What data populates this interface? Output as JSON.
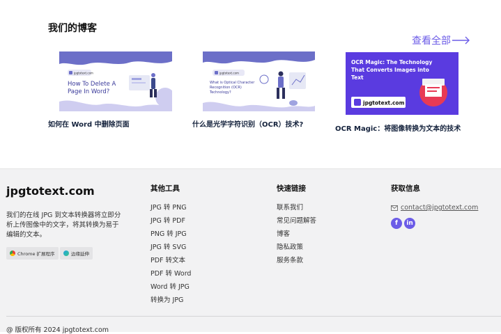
{
  "blog": {
    "title": "我们的博客",
    "view_all": "查看全部",
    "cards": [
      {
        "thumb_brand": "jpgtotext.com",
        "thumb_text_1": "How To Delete A",
        "thumb_text_2": "Page In Word?",
        "title": "如何在 Word 中删除页面"
      },
      {
        "thumb_brand": "jpgtotext.com",
        "thumb_text_1": "What is Optical Character",
        "thumb_text_2": "Recognition (OCR)",
        "thumb_text_3": "Technology?",
        "title": "什么是光学字符识别（OCR）技术?"
      },
      {
        "thumb_text_1": "OCR Magic: The Technology",
        "thumb_text_2": "That Converts Images into",
        "thumb_text_3": "Text",
        "thumb_brand": "jpgtotext.com",
        "title": "OCR Magic：将图像转换为文本的技术"
      }
    ]
  },
  "footer": {
    "brand": "jpgtotext.com",
    "description": "我们的在线 JPG 到文本转换器将立即分析上传图像中的文字，将其转换为易于编辑的文本。",
    "badges": [
      "Chrome 扩展程序",
      "边缘延伸"
    ],
    "other_tools": {
      "title": "其他工具",
      "items": [
        "JPG 转 PNG",
        "JPG 转 PDF",
        "PNG 转 JPG",
        "JPG 转 SVG",
        "PDF 转文本",
        "PDF 转 Word",
        "Word 转 JPG",
        "转换为 JPG"
      ]
    },
    "quick_links": {
      "title": "快速链接",
      "items": [
        "联系我们",
        "常见问题解答",
        "博客",
        "隐私政策",
        "服务条款"
      ]
    },
    "info": {
      "title": "获取信息",
      "email": "contact@jpgtotext.com",
      "social": [
        "f",
        "in"
      ]
    },
    "copyright": "@ 版权所有 2024 jpgtotext.com"
  },
  "colors": {
    "accent": "#6c5ce7",
    "footer_bg": "#f2f2f3",
    "card_title": "#14223c"
  }
}
